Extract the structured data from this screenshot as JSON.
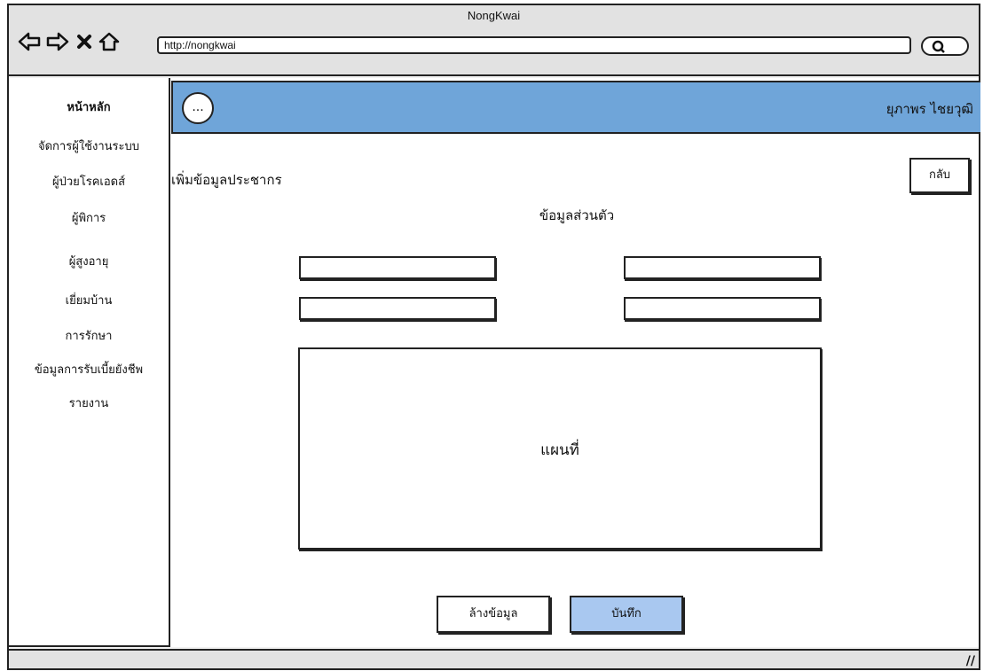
{
  "window": {
    "title": "NongKwai",
    "url": "http://nongkwai"
  },
  "sidebar": {
    "items": [
      {
        "label": "หน้าหลัก"
      },
      {
        "label": "จัดการผู้ใช้งานระบบ"
      },
      {
        "label": "ผู้ป่วยโรคเอดส์"
      },
      {
        "label": "ผู้พิการ"
      },
      {
        "label": "ผู้สูงอายุ"
      },
      {
        "label": "เยี่ยมบ้าน"
      },
      {
        "label": "การรักษา"
      },
      {
        "label": "ข้อมูลการรับเบี้ยยังชีพ"
      },
      {
        "label": "รายงาน"
      }
    ]
  },
  "header": {
    "menu_label": "...",
    "user_name": "ยุภาพร  ไชยวุฒิ"
  },
  "main": {
    "page_title": "เพิ่มข้อมูลประชากร",
    "back_label": "กลับ",
    "section_title": "ข้อมูลส่วนตัว",
    "map_label": "แผนที่",
    "clear_label": "ล้างข้อมูล",
    "save_label": "บันทึก"
  },
  "colors": {
    "header_bar": "#6fa5d9",
    "save_button": "#a9c8f0"
  }
}
